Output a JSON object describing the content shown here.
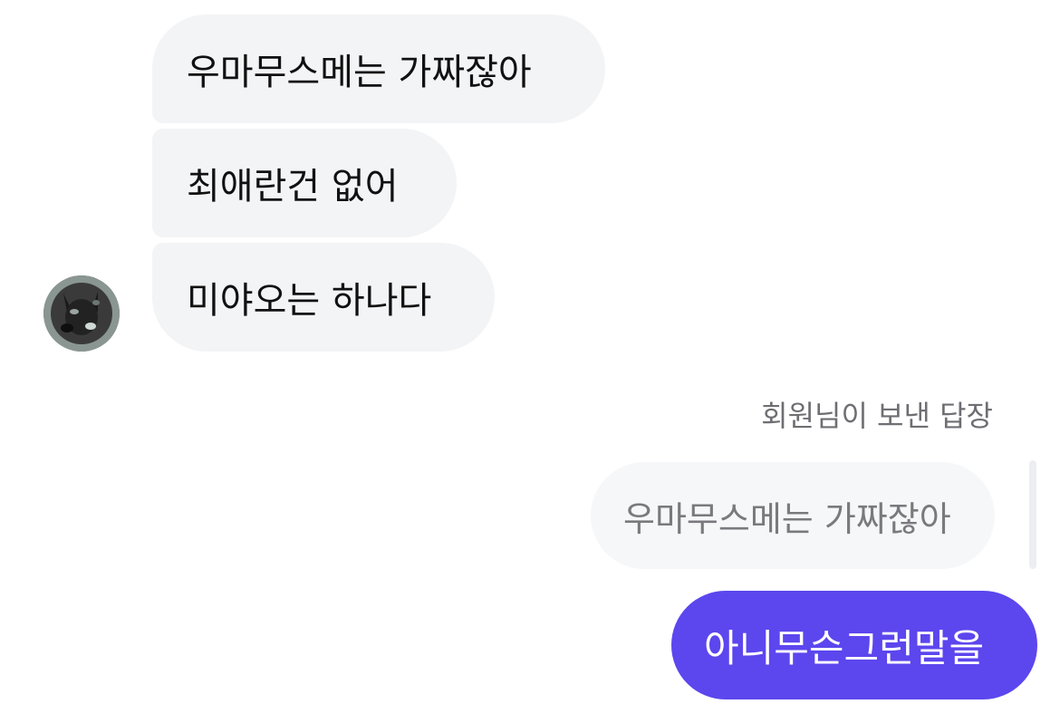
{
  "conversation": {
    "incoming_messages": [
      {
        "text": "우마무스메는 가짜잖아"
      },
      {
        "text": "최애란건 없어"
      },
      {
        "text": "미야오는 하나다"
      }
    ],
    "reply_label": "회원님이 보낸 답장",
    "reply_quote": "우마무스메는 가짜잖아",
    "outgoing_message": "아니무슨그런말을"
  },
  "colors": {
    "incoming_bubble": "#f3f4f6",
    "outgoing_bubble": "#5c46ee",
    "quote_bubble": "#f6f7f9",
    "secondary_text": "#6e6e73"
  }
}
